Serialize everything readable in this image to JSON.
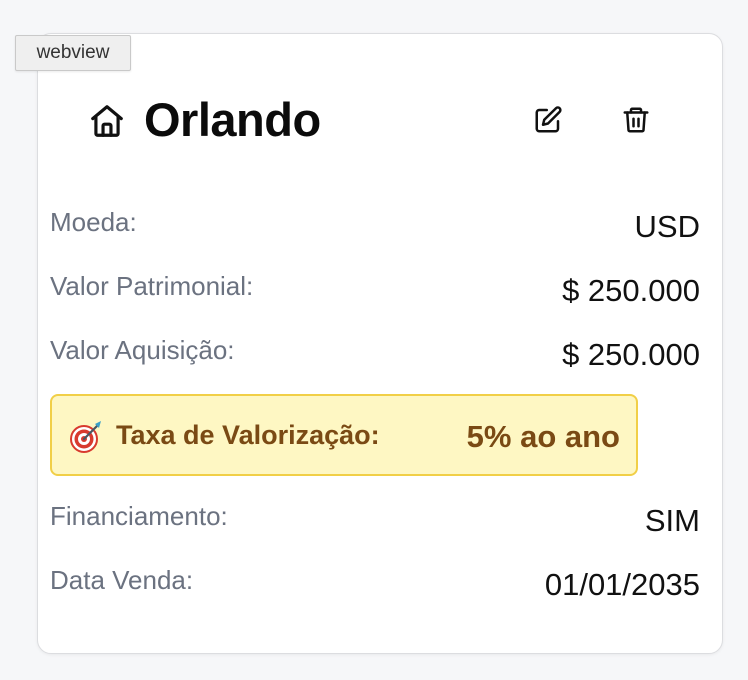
{
  "tooltip": {
    "text": "webview"
  },
  "card": {
    "title": "Orlando",
    "icons": {
      "home": "home-icon",
      "edit": "edit-icon",
      "delete": "trash-icon"
    },
    "fields": [
      {
        "label": "Moeda:",
        "value": "USD"
      },
      {
        "label": "Valor Patrimonial:",
        "value": "$ 250.000"
      },
      {
        "label": "Valor Aquisição:",
        "value": "$ 250.000"
      }
    ],
    "highlight": {
      "icon": "target-icon",
      "label": "Taxa de Valorização:",
      "value": "5% ao ano",
      "background": "#fef7c3",
      "border": "#f1cf47",
      "text_color": "#7a4a14"
    },
    "fields_after": [
      {
        "label": "Financiamento:",
        "value": "SIM"
      },
      {
        "label": "Data Venda:",
        "value": "01/01/2035"
      }
    ]
  }
}
